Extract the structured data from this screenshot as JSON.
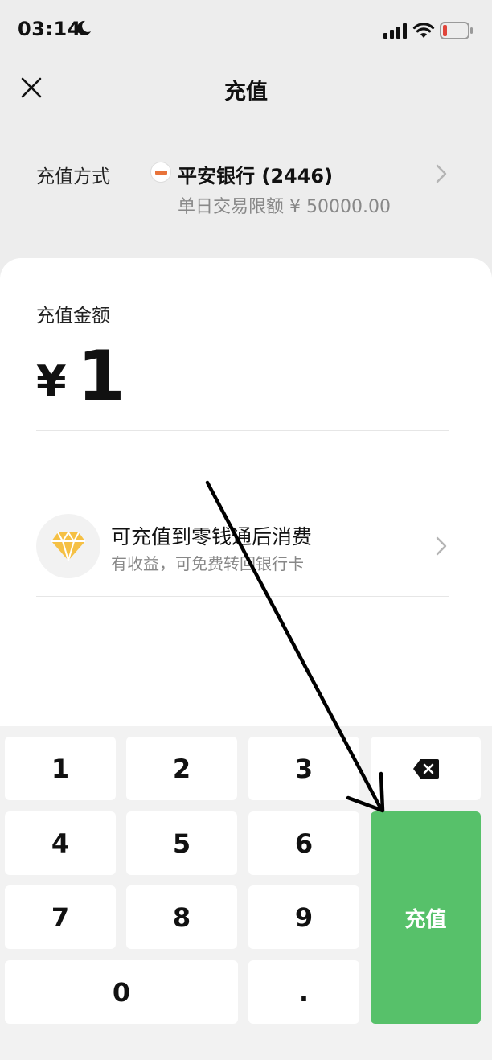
{
  "status_bar": {
    "time": "03:14",
    "icons": [
      "moon-icon",
      "signal-icon",
      "wifi-icon",
      "battery-low-icon"
    ],
    "battery_color": "#e0443a"
  },
  "header": {
    "title": "充值",
    "close_icon": "close-icon"
  },
  "payment_method": {
    "label": "充值方式",
    "bank_name": "平安银行 (2446)",
    "limit_text": "单日交易限额 ¥ 50000.00",
    "bank_icon": "bank-card-icon"
  },
  "amount": {
    "label": "充值金额",
    "currency": "¥",
    "value": "1"
  },
  "promo": {
    "title": "可充值到零钱通后消费",
    "subtitle": "有收益，可免费转回银行卡",
    "icon": "diamond-icon",
    "icon_color": "#f5c044"
  },
  "keypad": {
    "keys": [
      "1",
      "2",
      "3",
      "4",
      "5",
      "6",
      "7",
      "8",
      "9",
      "0",
      "."
    ],
    "delete_icon": "backspace-icon",
    "submit_label": "充值",
    "submit_color": "#57c16a"
  },
  "annotation": {
    "icon": "arrow-annotation-icon",
    "color": "#000000"
  }
}
